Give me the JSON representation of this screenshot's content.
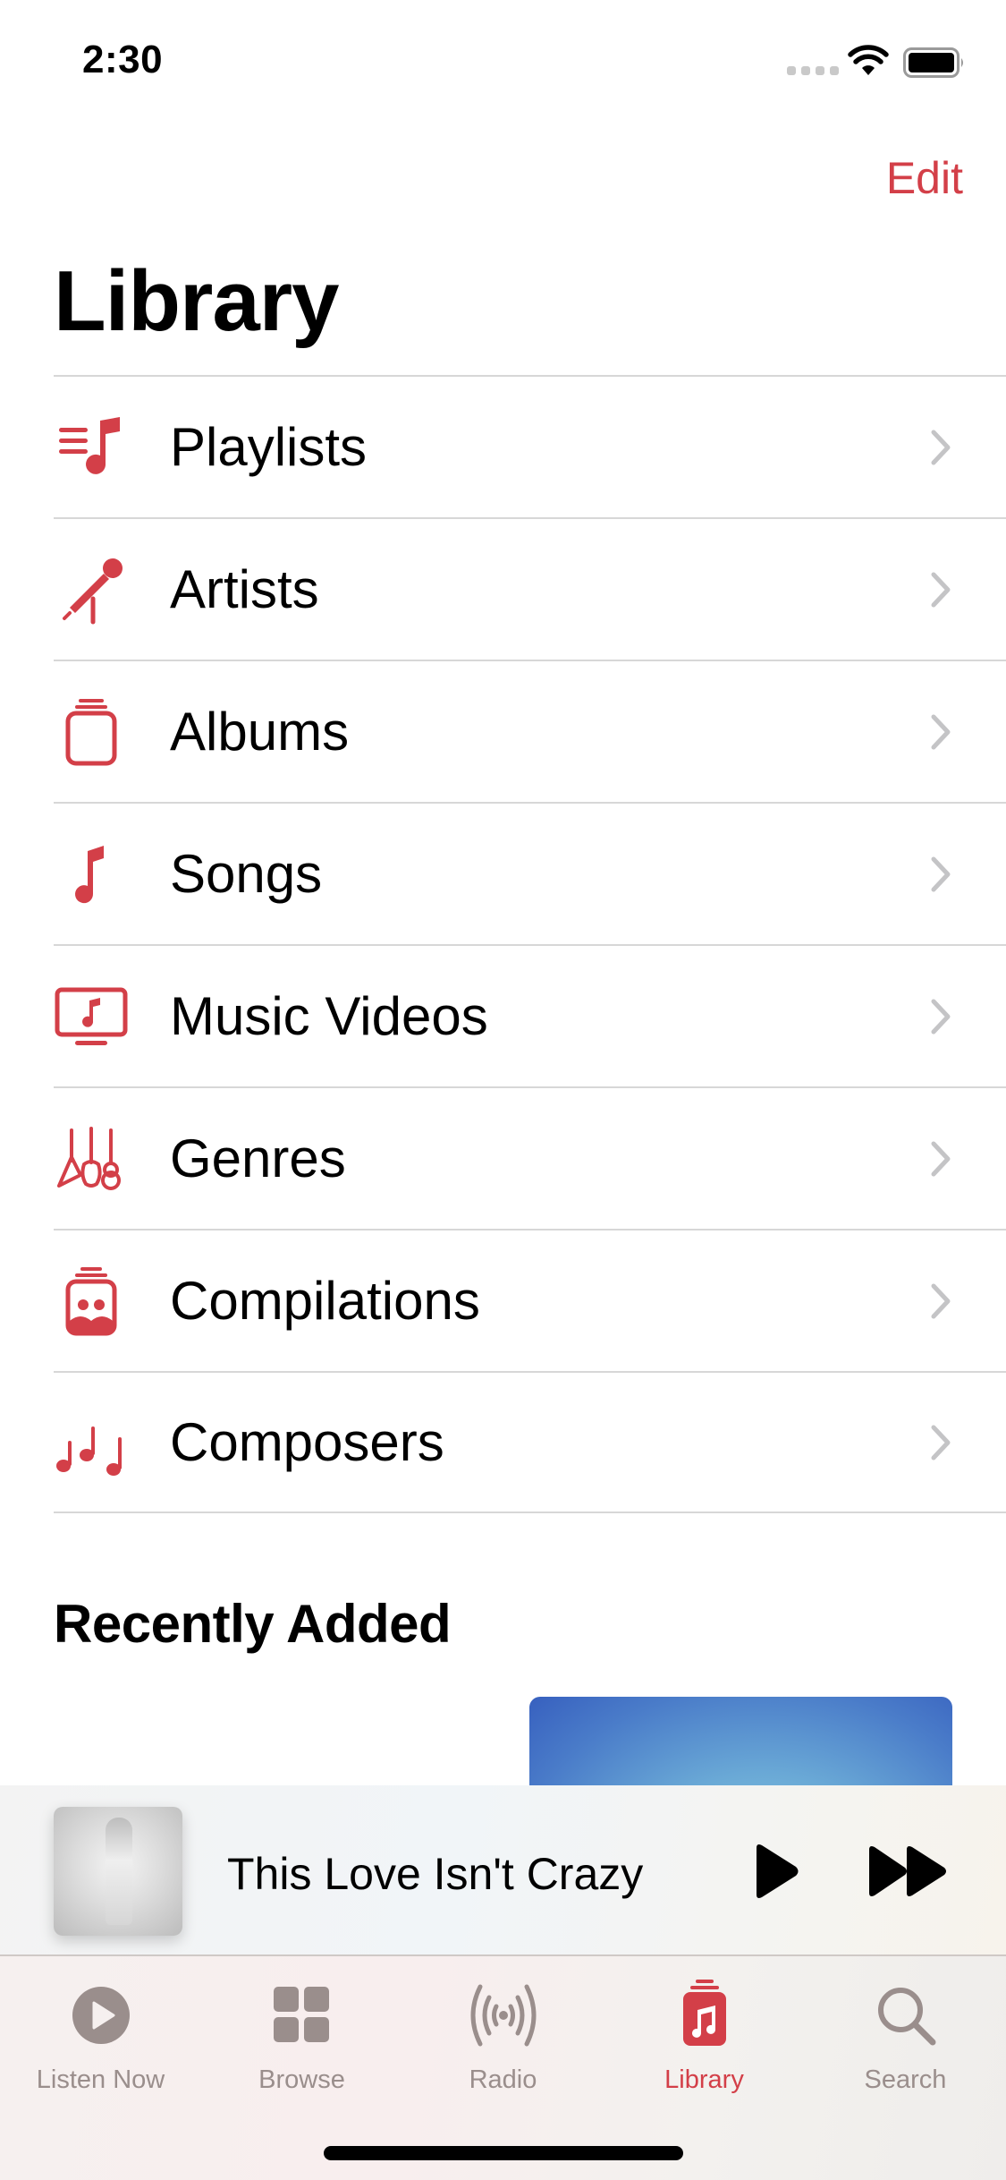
{
  "status_bar": {
    "time": "2:30",
    "signal_icon": "cellular-signal-icon",
    "wifi_icon": "wifi-icon",
    "battery_icon": "battery-icon"
  },
  "nav": {
    "edit_label": "Edit",
    "title": "Library"
  },
  "colors": {
    "accent": "#d33f48",
    "tab_inactive": "#9a8e8c",
    "chevron": "#c4c4c6",
    "divider": "#d7d7d7"
  },
  "library_items": [
    {
      "label": "Playlists",
      "icon": "playlist-icon"
    },
    {
      "label": "Artists",
      "icon": "microphone-icon"
    },
    {
      "label": "Albums",
      "icon": "album-stack-icon"
    },
    {
      "label": "Songs",
      "icon": "music-note-icon"
    },
    {
      "label": "Music Videos",
      "icon": "music-video-tv-icon"
    },
    {
      "label": "Genres",
      "icon": "guitars-icon"
    },
    {
      "label": "Compilations",
      "icon": "compilation-icon"
    },
    {
      "label": "Composers",
      "icon": "music-notes-icon"
    }
  ],
  "recently_added": {
    "title": "Recently Added"
  },
  "mini_player": {
    "title": "This Love Isn't Crazy",
    "play_icon": "play-icon",
    "forward_icon": "fast-forward-icon"
  },
  "tabs": [
    {
      "label": "Listen Now",
      "icon": "play-circle-icon",
      "active": false
    },
    {
      "label": "Browse",
      "icon": "grid-icon",
      "active": false
    },
    {
      "label": "Radio",
      "icon": "radio-waves-icon",
      "active": false
    },
    {
      "label": "Library",
      "icon": "library-icon",
      "active": true
    },
    {
      "label": "Search",
      "icon": "search-icon",
      "active": false
    }
  ]
}
